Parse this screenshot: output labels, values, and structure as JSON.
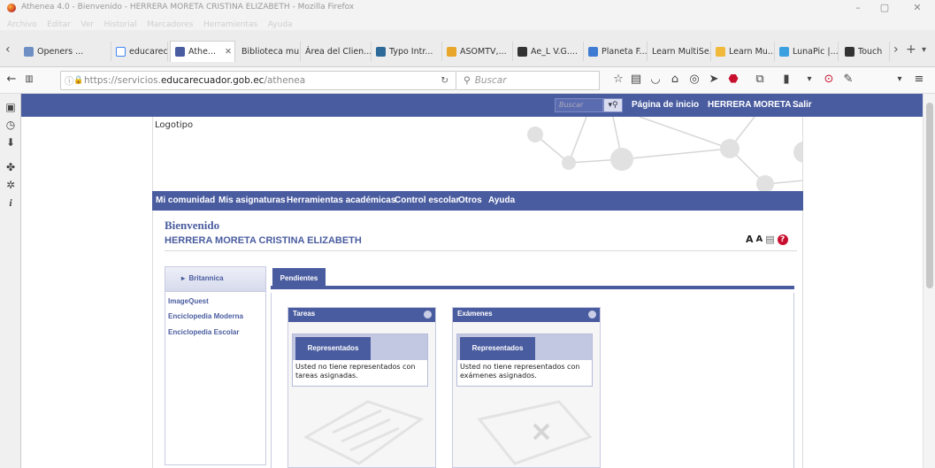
{
  "window": {
    "title": "Athenea 4.0 - Bienvenido - HERRERA MORETA CRISTINA ELIZABETH - Mozilla Firefox",
    "menu": [
      "Archivo",
      "Editar",
      "Ver",
      "Historial",
      "Marcadores",
      "Herramientas",
      "Ayuda"
    ]
  },
  "tabs": [
    {
      "label": "Openers ...",
      "color": "#6d8fc4"
    },
    {
      "label": "educarec...",
      "color": "#ffffff"
    },
    {
      "label": "Athe...",
      "color": "#4a5ca0",
      "active": true
    },
    {
      "label": "Biblioteca mu...",
      "color": "#ececec"
    },
    {
      "label": "Área del Clien...",
      "color": "#ececec"
    },
    {
      "label": "Typo Intr...",
      "color": "#2d6a9a"
    },
    {
      "label": "ASOMTV,...",
      "color": "#e8a72a"
    },
    {
      "label": "Ae_L V.G....",
      "color": "#333333"
    },
    {
      "label": "Planeta F...",
      "color": "#3f7bd3"
    },
    {
      "label": "Learn MultiSe...",
      "color": "#ececec"
    },
    {
      "label": "Learn Mu...",
      "color": "#f0b93a"
    },
    {
      "label": "LunaPic |...",
      "color": "#3aa0e0"
    },
    {
      "label": "Touch",
      "color": "#333333"
    }
  ],
  "nav": {
    "url_prefix": "https://servicios.",
    "url_domain": "educarecuador.gob.ec",
    "url_path": "/athenea",
    "search_placeholder": "Buscar"
  },
  "site": {
    "search_placeholder": "Buscar",
    "links": [
      "Página de inicio",
      "HERRERA MORETA ...",
      "Salir"
    ],
    "logo_text": "Logotipo",
    "menu": [
      "Mi comunidad",
      "Mis asignaturas",
      "Herramientas académicas",
      "Control escolar",
      "Otros",
      "Ayuda"
    ],
    "welcome": "Bienvenido",
    "user_name": "HERRERA MORETA CRISTINA ELIZABETH",
    "tools": [
      "A",
      "A"
    ],
    "left_panel": {
      "header": "Britannica",
      "links": [
        "ImageQuest",
        "Enciclopedia Moderna",
        "Enciclopedia Escolar"
      ]
    },
    "pending_tab": "Pendientes",
    "widgets": [
      {
        "title": "Tareas",
        "button": "Representados",
        "message": "Usted no tiene representados con tareas asignadas."
      },
      {
        "title": "Exámenes",
        "button": "Representados",
        "message": "Usted no tiene representados con exámenes asignados."
      }
    ]
  },
  "colors": {
    "brand": "#4a5ca0",
    "help": "#c8102e"
  }
}
